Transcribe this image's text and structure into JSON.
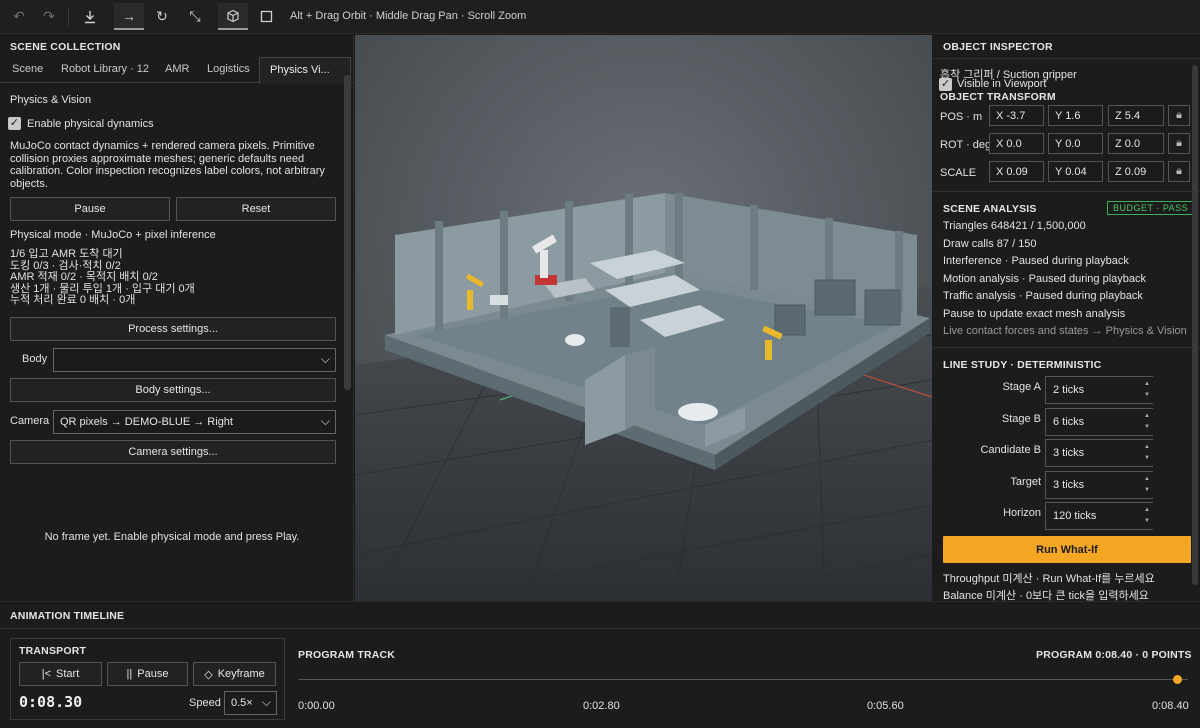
{
  "toolbar": {
    "hint": "Alt + Drag Orbit · Middle Drag Pan · Scroll Zoom"
  },
  "left": {
    "title": "SCENE COLLECTION",
    "tabs": [
      "Scene",
      "Robot Library · 12",
      "AMR",
      "Logistics",
      "Physics  Vi..."
    ],
    "heading": "Physics & Vision",
    "enable_label": "Enable physical dynamics",
    "description": "MuJoCo contact dynamics + rendered camera pixels. Primitive collision proxies approximate meshes; generic defaults need calibration. Color inspection recognizes label colors, not arbitrary objects.",
    "pause_label": "Pause",
    "reset_label": "Reset",
    "mode_line": "Physical mode · MuJoCo + pixel inference",
    "status_lines": [
      "1/6 입고 AMR 도착 대기",
      "도킹 0/3 · 검사·적치 0/2",
      "AMR 적재 0/2 · 목적지 배치 0/2",
      "생산 1개 · 물리 투입 1개 · 입구 대기 0개",
      "누적 처리 완료 0 배치 · 0개"
    ],
    "process_settings": "Process settings...",
    "body_label": "Body",
    "body_value": "",
    "body_settings": "Body settings...",
    "camera_label": "Camera",
    "camera_value": "QR pixels → DEMO-BLUE → Right",
    "camera_settings": "Camera settings...",
    "no_frame": "No frame yet. Enable physical mode and press Play."
  },
  "right": {
    "title": "OBJECT INSPECTOR",
    "object_name": "흡착 그리퍼 / Suction gripper",
    "visible_label": "Visible in Viewport",
    "transform_title": "OBJECT TRANSFORM",
    "rows": [
      {
        "label": "POS · m",
        "x": "X -3.7",
        "y": "Y 1.6",
        "z": "Z 5.4"
      },
      {
        "label": "ROT · deg",
        "x": "X 0.0",
        "y": "Y 0.0",
        "z": "Z 0.0"
      },
      {
        "label": "SCALE",
        "x": "X 0.09",
        "y": "Y 0.04",
        "z": "Z 0.09"
      }
    ],
    "analysis_title": "SCENE ANALYSIS",
    "budget_badge": "BUDGET · PASS",
    "triangles": "Triangles  648421 / 1,500,000",
    "draw_calls": "Draw calls  87 / 150",
    "interference": "Interference · Paused during playback",
    "motion": "Motion analysis · Paused during playback",
    "traffic": "Traffic analysis · Paused during playback",
    "pause_update": "Pause to update exact mesh analysis",
    "live_contact": "Live contact forces and states → Physics & Vision",
    "line_study_title": "LINE STUDY · DETERMINISTIC",
    "study": [
      {
        "label": "Stage A",
        "value": "2 ticks"
      },
      {
        "label": "Stage B",
        "value": "6 ticks"
      },
      {
        "label": "Candidate B",
        "value": "3 ticks"
      },
      {
        "label": "Target",
        "value": "3 ticks"
      },
      {
        "label": "Horizon",
        "value": "120 ticks"
      }
    ],
    "run_label": "Run What-If",
    "throughput": "Throughput  미계산 · Run What-If를 누르세요",
    "balance": "Balance  미계산 · 0보다 큰 tick을 입력하세요",
    "accent": "#f5a623"
  },
  "timeline": {
    "title": "ANIMATION TIMELINE",
    "transport_title": "TRANSPORT",
    "start_label": "Start",
    "pause_label": "Pause",
    "keyframe_label": "Keyframe",
    "time": "0:08.30",
    "speed_label": "Speed",
    "speed_value": "0.5×",
    "track_title": "PROGRAM TRACK",
    "program_info": "PROGRAM  0:08.40 · 0 POINTS",
    "ticks": [
      "0:00.00",
      "0:02.80",
      "0:05.60",
      "0:08.40"
    ],
    "playhead_fraction": 0.988
  }
}
